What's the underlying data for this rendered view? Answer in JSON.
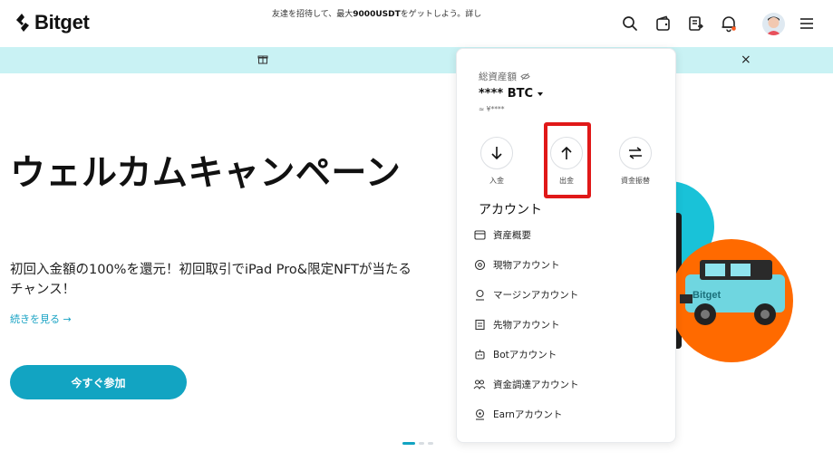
{
  "header": {
    "brand": "Bitget",
    "icons": [
      "search-icon",
      "wallet-icon",
      "orders-icon",
      "bell-icon",
      "avatar",
      "menu-icon"
    ],
    "accent": "#12a4c2",
    "notification_dot_color": "#ff5a1f"
  },
  "banner": {
    "text_before": "友達を招待して、最大",
    "text_bold": "9000USDT",
    "text_after": "をゲットしよう。詳し",
    "close": "×",
    "background": "#c9f2f4"
  },
  "hero": {
    "title": "ウェルカムキャンペーン",
    "subtitle": "初回入金額の100%を還元！初回取引でiPad Pro&限定NFTが当たるチャンス！",
    "more_link": "続きを見る →",
    "cta": "今すぐ参加",
    "carousel_dots": 3,
    "carousel_active": 1
  },
  "assets_panel": {
    "total_label": "総資産額",
    "balance": "**** BTC",
    "approx": "≈ ¥****",
    "actions": [
      {
        "icon": "arrow-down-icon",
        "label": "入金"
      },
      {
        "icon": "arrow-up-icon",
        "label": "出金"
      },
      {
        "icon": "transfer-icon",
        "label": "資金振替"
      }
    ],
    "highlighted_action": "出金",
    "highlight_color": "#e01818",
    "section_title": "アカウント",
    "accounts": [
      {
        "icon": "overview-icon",
        "label": "資産概要"
      },
      {
        "icon": "spot-icon",
        "label": "現物アカウント"
      },
      {
        "icon": "margin-icon",
        "label": "マージンアカウント"
      },
      {
        "icon": "futures-icon",
        "label": "先物アカウント"
      },
      {
        "icon": "bot-icon",
        "label": "Botアカウント"
      },
      {
        "icon": "funding-icon",
        "label": "資金調達アカウント"
      },
      {
        "icon": "earn-icon",
        "label": "Earnアカウント"
      }
    ]
  }
}
